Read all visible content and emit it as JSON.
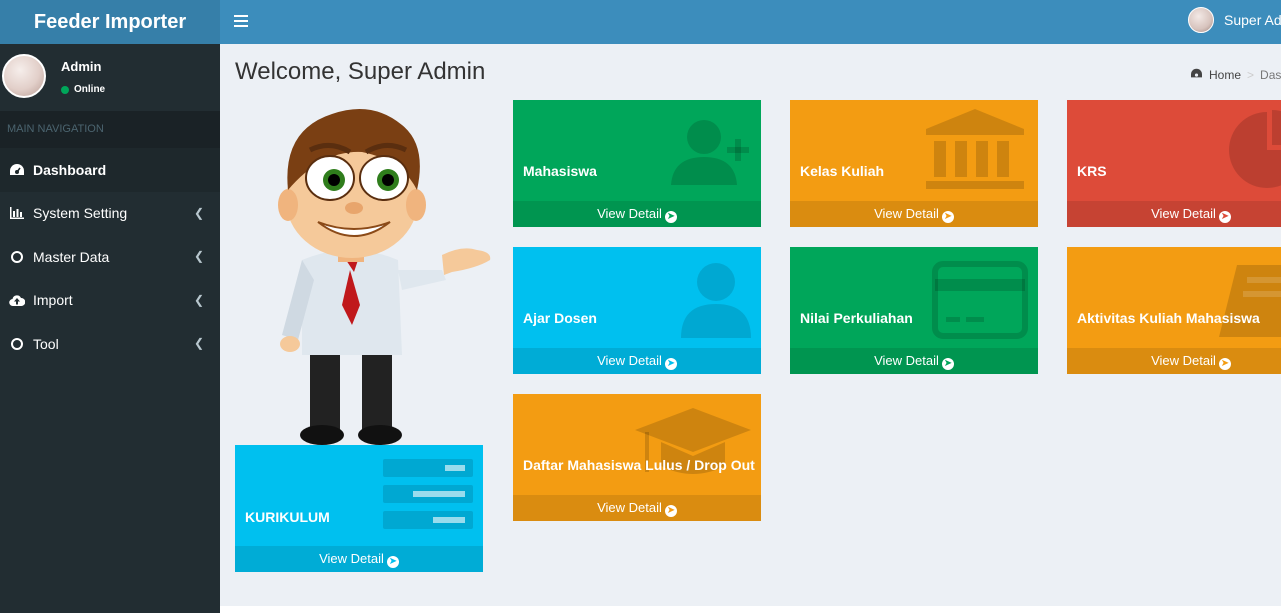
{
  "app": {
    "logo_text": "Feeder Importer"
  },
  "navbar": {
    "user_name": "Super Admin"
  },
  "sidebar": {
    "user": {
      "name": "Admin",
      "status": "Online"
    },
    "section_header": "MAIN NAVIGATION",
    "items": [
      {
        "label": "Dashboard",
        "icon": "dashboard-icon"
      },
      {
        "label": "System Setting",
        "icon": "bar-chart-icon"
      },
      {
        "label": "Master Data",
        "icon": "circle-o-icon"
      },
      {
        "label": "Import",
        "icon": "cloud-upload-icon"
      },
      {
        "label": "Tool",
        "icon": "circle-o-icon"
      }
    ]
  },
  "page": {
    "title": "Welcome, Super Admin",
    "breadcrumb": {
      "home": "Home",
      "current": "Dashboard"
    }
  },
  "boxes": [
    {
      "label": "Mahasiswa",
      "footer": "View Detail",
      "color": "#00a65a",
      "icon": "user-plus-icon"
    },
    {
      "label": "Kelas Kuliah",
      "footer": "View Detail",
      "color": "#f39c12",
      "icon": "institution-icon"
    },
    {
      "label": "KRS",
      "footer": "View Detail",
      "color": "#dd4b39",
      "icon": "pie-chart-icon"
    },
    {
      "label": "Ajar Dosen",
      "footer": "View Detail",
      "color": "#00c0ef",
      "icon": "user-icon"
    },
    {
      "label": "Nilai Perkuliahan",
      "footer": "View Detail",
      "color": "#00a65a",
      "icon": "credit-card-icon"
    },
    {
      "label": "Aktivitas Kuliah Mahasiswa",
      "footer": "View Detail",
      "color": "#f39c12",
      "icon": "book-icon"
    },
    {
      "label": "Daftar Mahasiswa Lulus / Drop Out",
      "footer": "View Detail",
      "color": "#f39c12",
      "icon": "graduation-cap-icon"
    },
    {
      "label": "KURIKULUM",
      "footer": "View Detail",
      "color": "#00c0ef",
      "icon": "tasks-icon"
    }
  ]
}
